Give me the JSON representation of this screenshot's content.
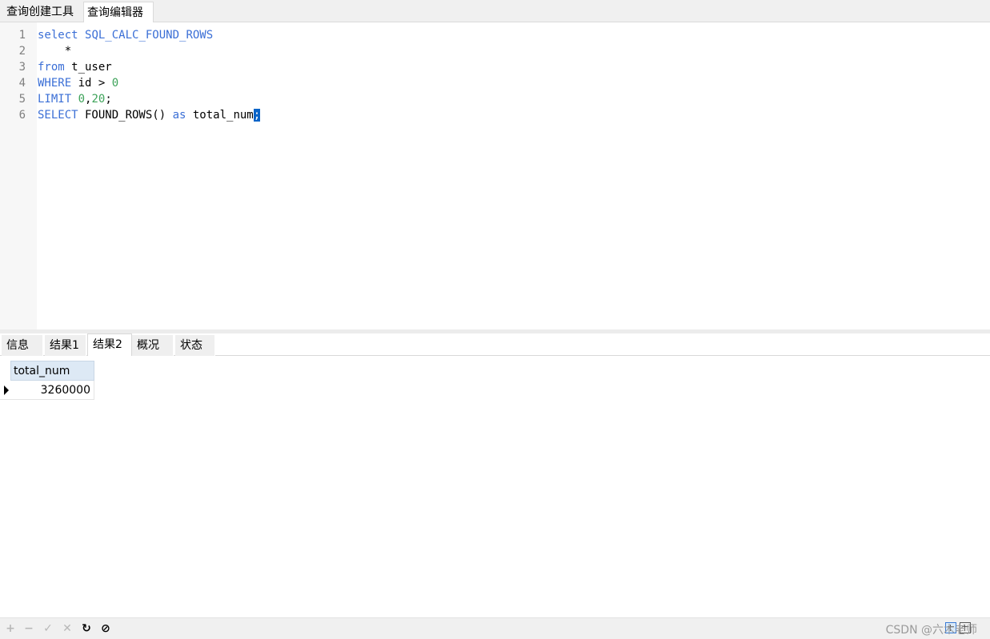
{
  "top_tabs": [
    {
      "label": "查询创建工具",
      "active": false
    },
    {
      "label": "查询编辑器",
      "active": true
    }
  ],
  "editor": {
    "line_numbers": [
      "1",
      "2",
      "3",
      "4",
      "5",
      "6"
    ],
    "lines": [
      [
        {
          "t": "select",
          "k": "kw"
        },
        {
          "t": " "
        },
        {
          "t": "SQL_CALC_FOUND_ROWS",
          "k": "kw"
        }
      ],
      [
        {
          "t": "    *"
        }
      ],
      [
        {
          "t": "from",
          "k": "kw"
        },
        {
          "t": " t_user"
        }
      ],
      [
        {
          "t": "WHERE",
          "k": "kw"
        },
        {
          "t": " id > "
        },
        {
          "t": "0",
          "k": "num"
        }
      ],
      [
        {
          "t": "LIMIT",
          "k": "kw"
        },
        {
          "t": " "
        },
        {
          "t": "0",
          "k": "num"
        },
        {
          "t": ","
        },
        {
          "t": "20",
          "k": "num"
        },
        {
          "t": ";"
        }
      ],
      [
        {
          "t": "SELECT",
          "k": "kw"
        },
        {
          "t": " FOUND_ROWS() "
        },
        {
          "t": "as",
          "k": "kw"
        },
        {
          "t": " total_num"
        },
        {
          "t": ";",
          "k": "sel"
        }
      ]
    ]
  },
  "result_tabs": [
    {
      "label": "信息",
      "active": false
    },
    {
      "label": "结果1",
      "active": false
    },
    {
      "label": "结果2",
      "active": true
    },
    {
      "label": "概况",
      "active": false
    },
    {
      "label": "状态",
      "active": false
    }
  ],
  "result_grid": {
    "columns": [
      "total_num"
    ],
    "rows": [
      [
        "3260000"
      ]
    ]
  },
  "bottom_bar": {
    "buttons": [
      {
        "name": "add-record-button",
        "glyph": "+",
        "enabled": false
      },
      {
        "name": "delete-record-button",
        "glyph": "−",
        "enabled": false
      },
      {
        "name": "apply-changes-button",
        "glyph": "✓",
        "enabled": false
      },
      {
        "name": "discard-changes-button",
        "glyph": "✕",
        "enabled": false
      },
      {
        "name": "refresh-button",
        "glyph": "↻",
        "enabled": true
      },
      {
        "name": "stop-button",
        "glyph": "⊘",
        "enabled": true
      }
    ],
    "watermark": "CSDN @六木老师"
  },
  "colors": {
    "keyword": "#3b6fd6",
    "number": "#3ea35a",
    "selection": "#0a64c8",
    "grid_header": "#dde9f5"
  }
}
